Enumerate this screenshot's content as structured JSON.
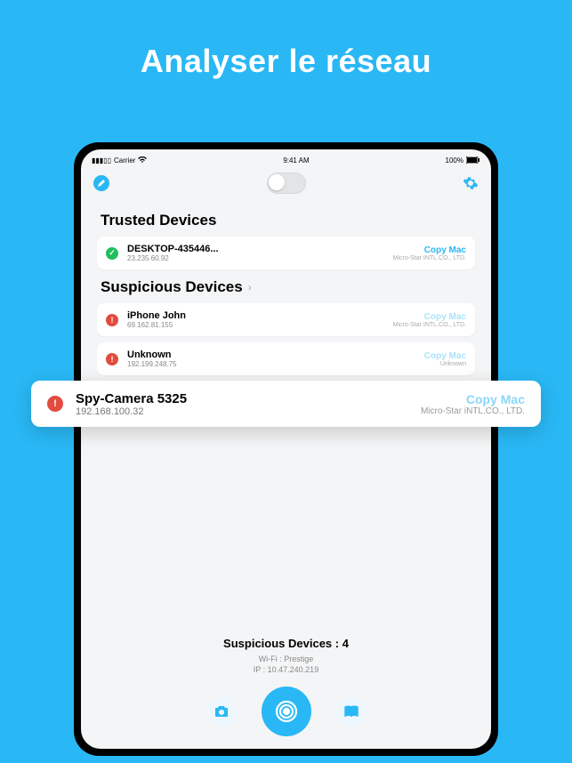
{
  "marketing_title": "Analyser le réseau",
  "statusbar": {
    "carrier": "Carrier",
    "time": "9:41 AM",
    "battery": "100%"
  },
  "sections": {
    "trusted_title": "Trusted Devices",
    "suspicious_title": "Suspicious Devices"
  },
  "trusted": [
    {
      "name": "DESKTOP-435446...",
      "ip": "23.235.60.92",
      "copy": "Copy Mac",
      "vendor": "Micro-Star INTL.CO., LTD."
    }
  ],
  "suspicious": [
    {
      "name": "iPhone John",
      "ip": "69.162.81.155",
      "copy": "Copy Mac",
      "vendor": "Micro-Star INTL.CO., LTD."
    },
    {
      "name": "Unknown",
      "ip": "192.199.248.75",
      "copy": "Copy Mac",
      "vendor": "Unknown"
    }
  ],
  "highlight": {
    "name": "Spy-Camera 5325",
    "ip": "192.168.100.32",
    "copy": "Copy Mac",
    "vendor": "Micro-Star iNTL.CO., LTD."
  },
  "footer": {
    "count_label": "Suspicious Devices : 4",
    "wifi": "Wi-Fi : Prestige",
    "ip": "IP : 10.47.240.219"
  }
}
